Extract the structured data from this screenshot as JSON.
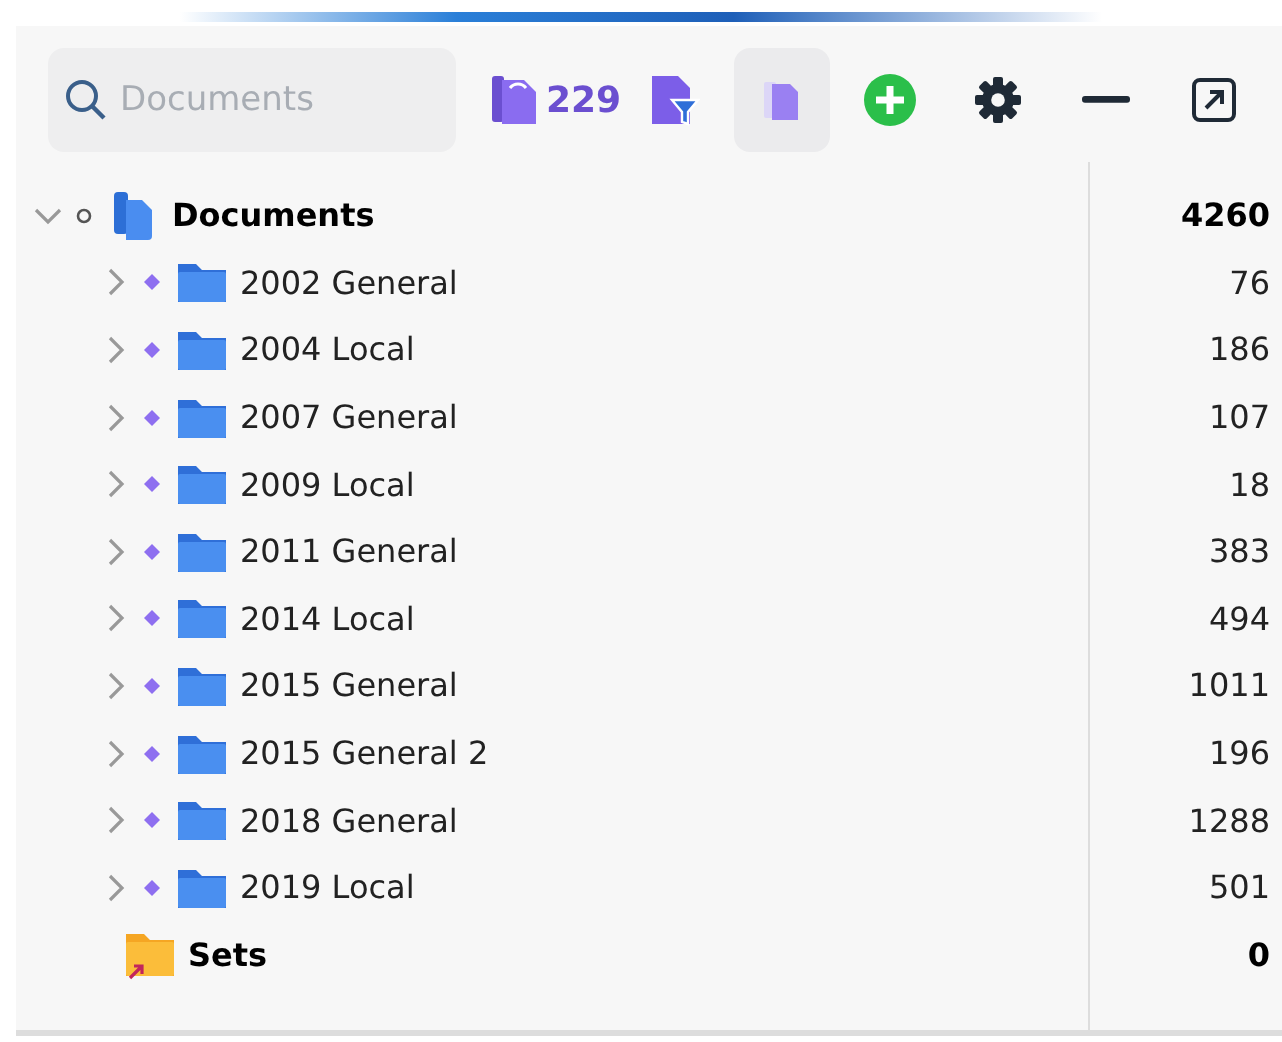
{
  "toolbar": {
    "search": {
      "placeholder": "Documents"
    },
    "count": "229",
    "filter_toggle": {
      "selected": true
    }
  },
  "tree": [
    {
      "kind": "documents",
      "label": "Documents",
      "count": "4260",
      "expanded": true,
      "children": [
        {
          "kind": "folder",
          "label": "2002 General",
          "count": "76",
          "expanded": false
        },
        {
          "kind": "folder",
          "label": "2004 Local",
          "count": "186",
          "expanded": false
        },
        {
          "kind": "folder",
          "label": "2007 General",
          "count": "107",
          "expanded": false
        },
        {
          "kind": "folder",
          "label": "2009 Local",
          "count": "18",
          "expanded": false
        },
        {
          "kind": "folder",
          "label": "2011 General",
          "count": "383",
          "expanded": false
        },
        {
          "kind": "folder",
          "label": "2014 Local",
          "count": "494",
          "expanded": false
        },
        {
          "kind": "folder",
          "label": "2015 General",
          "count": "1011",
          "expanded": false
        },
        {
          "kind": "folder",
          "label": "2015 General 2",
          "count": "196",
          "expanded": false
        },
        {
          "kind": "folder",
          "label": "2018 General",
          "count": "1288",
          "expanded": false
        },
        {
          "kind": "folder",
          "label": "2019 Local",
          "count": "501",
          "expanded": false
        }
      ]
    },
    {
      "kind": "sets",
      "label": "Sets",
      "count": "0"
    }
  ]
}
